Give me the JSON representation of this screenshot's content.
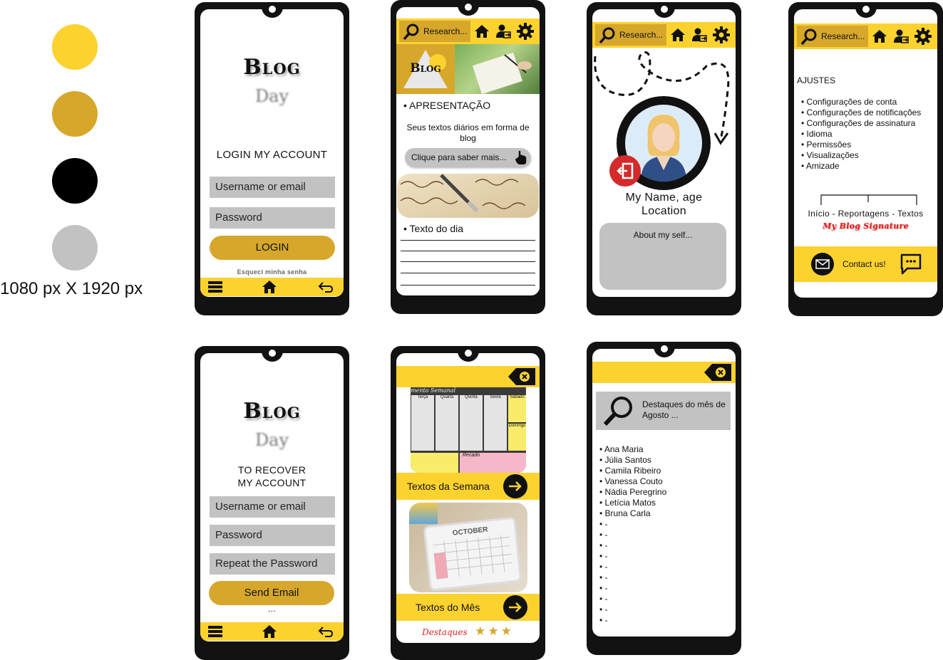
{
  "palette": {
    "colors": [
      "#fcd22f",
      "#d6a72b",
      "#000000",
      "#c3c2c3"
    ],
    "dimensions": "1080 px X 1920 px"
  },
  "login_screen": {
    "logo_title": "Blog",
    "logo_sub": "Day",
    "heading": "LOGIN MY ACCOUNT",
    "username_placeholder": "Username or email",
    "password_placeholder": "Password",
    "login_button": "LOGIN",
    "forgot_link": "Esqueci minha senha",
    "nav": [
      "menu-icon",
      "home-icon",
      "back-icon"
    ]
  },
  "recover_screen": {
    "logo_title": "Blog",
    "logo_sub": "Day",
    "heading_line1": "TO RECOVER",
    "heading_line2": "MY ACCOUNT",
    "username_placeholder": "Username or email",
    "password_placeholder": "Password",
    "repeat_placeholder": "Repeat the Password",
    "send_button": "Send Email",
    "ellipsis": "..."
  },
  "home_screen": {
    "search_placeholder": "Research...",
    "logo_word": "Blog",
    "section_presentation": "APRESENTAÇÃO",
    "presentation_text": "Seus textos diários em forma de blog",
    "more_button": "Clique para saber mais...",
    "section_daily": "Texto do dia"
  },
  "profile_screen": {
    "search_placeholder": "Research...",
    "name_line": "My Name, age",
    "location_line": "Location",
    "about_placeholder": "About my self..."
  },
  "settings_screen": {
    "search_placeholder": "Research...",
    "heading": "AJUSTES",
    "items": [
      "Configurações de conta",
      "Configurações de notificações",
      "Configurações de assinatura",
      "Idioma",
      "Permissões",
      "Visualizações",
      "Amizade"
    ],
    "footer_links": "Início - Reportagens - Textos",
    "signature": "My Blog Signature",
    "contact_label": "Contact us!"
  },
  "menu_screen": {
    "planner_title": "mento Semanal",
    "planner_days": [
      "Terça",
      "Quarta",
      "Quinta",
      "Sexta",
      "Sábado"
    ],
    "planner_extra": [
      "Domingo",
      "Recado"
    ],
    "week_button": "Textos da Semana",
    "calendar_month": "OCTOBER",
    "month_button": "Textos do Mês",
    "highlights_label": "Destaques",
    "stars": "★★★"
  },
  "highlights_screen": {
    "search_text": "Destaques do mês de Agosto ...",
    "names": [
      "Ana Maria",
      "Júlia Santos",
      "Camila Ribeiro",
      "Vanessa Couto",
      "Nádia Peregrino",
      "Letícia Matos",
      "Bruna Carla",
      "-",
      "-",
      "-",
      "-",
      "-",
      "-",
      "-",
      "-",
      "-",
      "-"
    ]
  }
}
